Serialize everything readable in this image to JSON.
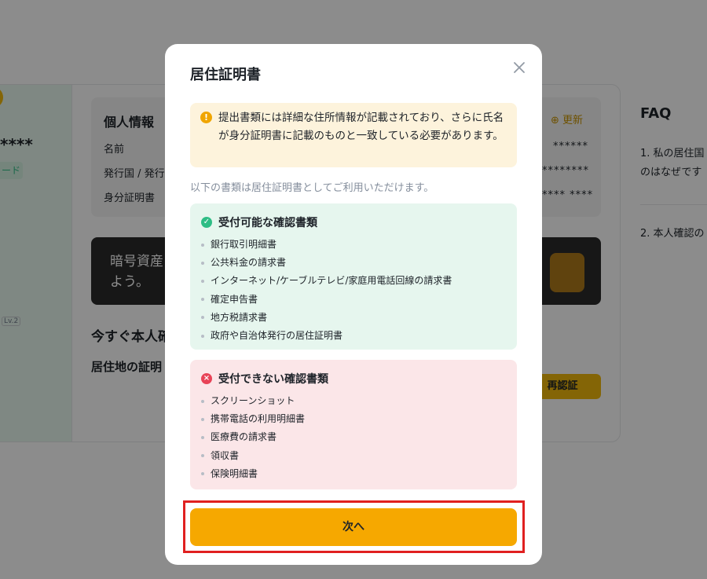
{
  "background": {
    "masked_name": "****",
    "tag_label": "ード",
    "level_badge": "Lv.2",
    "personal_info": {
      "title": "個人情報",
      "update_label": "更新",
      "rows": [
        {
          "label": "名前",
          "value": "******"
        },
        {
          "label": "発行国 / 発行",
          "value": "********"
        },
        {
          "label": "身分証明書",
          "value": "**** ****"
        }
      ]
    },
    "banner_text_line1": "暗号資産",
    "banner_text_line2": "よう。",
    "heading_verify": "今すぐ本人確",
    "heading_residence": "居住地の証明",
    "reauth_label": "再認証",
    "faq": {
      "title": "FAQ",
      "q1_line1": "1. 私の居住国",
      "q1_line2": "のはなぜです",
      "q2": "2. 本人確認の"
    }
  },
  "modal": {
    "title": "居住証明書",
    "warning": "提出書類には詳細な住所情報が記載されており、さらに氏名が身分証明書に記載のものと一致している必要があります。",
    "subtitle": "以下の書類は居住証明書としてご利用いただけます。",
    "accepted": {
      "title": "受付可能な確認書類",
      "items": [
        "銀行取引明細書",
        "公共料金の請求書",
        "インターネット/ケーブルテレビ/家庭用電話回線の請求書",
        "確定申告書",
        "地方税請求書",
        "政府や自治体発行の居住証明書"
      ]
    },
    "rejected": {
      "title": "受付できない確認書類",
      "items": [
        "スクリーンショット",
        "携帯電話の利用明細書",
        "医療費の請求書",
        "領収書",
        "保険明細書"
      ]
    },
    "next_label": "次へ"
  },
  "colors": {
    "accent": "#f6a800",
    "accepted_bg": "#e6f6ee",
    "rejected_bg": "#fbe6e8",
    "warning_bg": "#fdf3dc",
    "highlight": "#e02020"
  }
}
